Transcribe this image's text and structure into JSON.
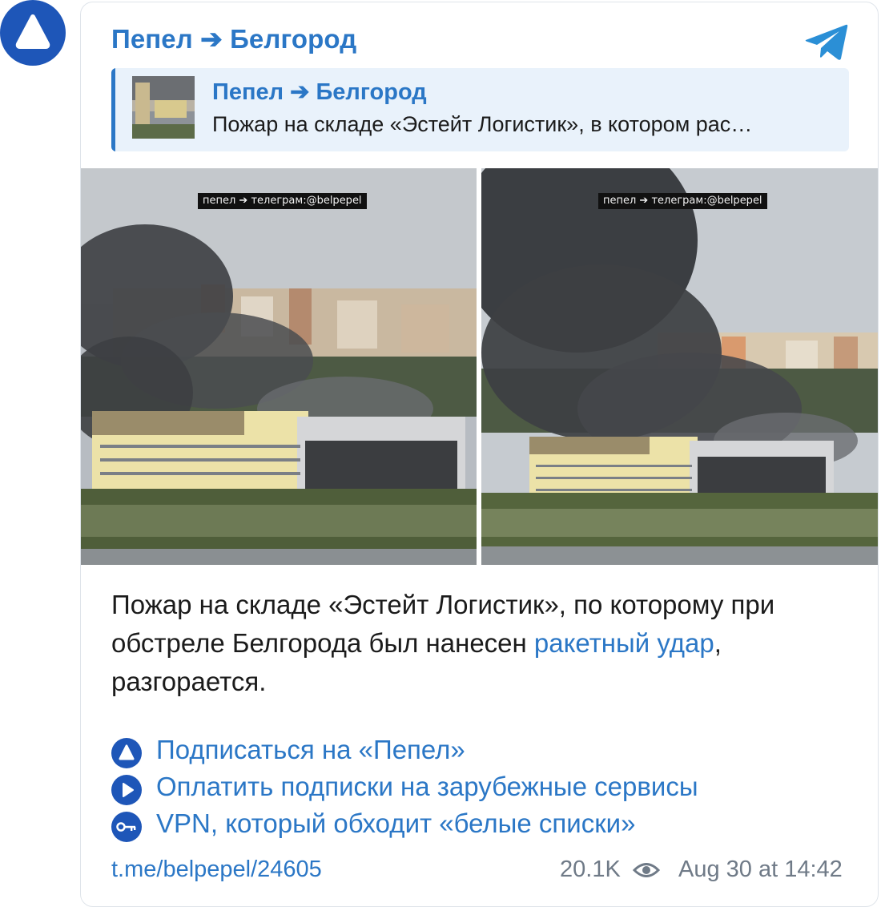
{
  "avatar": {
    "icon": "triangle-logo-icon",
    "color": "#1e56b8"
  },
  "header": {
    "channel_title": "Пепел ➔ Белгород",
    "app_icon": "telegram-icon"
  },
  "reply": {
    "title": "Пепел ➔ Белгород",
    "text": "Пожар на складе «Эстейт Логистик», в котором рас…"
  },
  "media": {
    "watermark_left": "пепел ➔ телеграм:@belpepel",
    "watermark_right": "пепел ➔ телеграм:@belpepel"
  },
  "post": {
    "text_before": "Пожар на складе «Эстейт Логистик», по которому при обстреле Белгорода был нанесен ",
    "link_text": "ракетный удар",
    "text_after": ", разгорается."
  },
  "links": [
    {
      "icon": "triangle-logo-icon",
      "label": "Подписаться на «Пепел»"
    },
    {
      "icon": "play-icon",
      "label": "Оплатить подписки на зарубежные сервисы"
    },
    {
      "icon": "key-icon",
      "label": "VPN, который обходит «белые списки»"
    }
  ],
  "footer": {
    "post_link": "t.me/belpepel/24605",
    "views": "20.1K",
    "views_icon": "eye-icon",
    "date": "Aug 30 at 14:42"
  },
  "colors": {
    "accent": "#2b77c6",
    "brand": "#1e56b8",
    "muted": "#6f7a87"
  }
}
